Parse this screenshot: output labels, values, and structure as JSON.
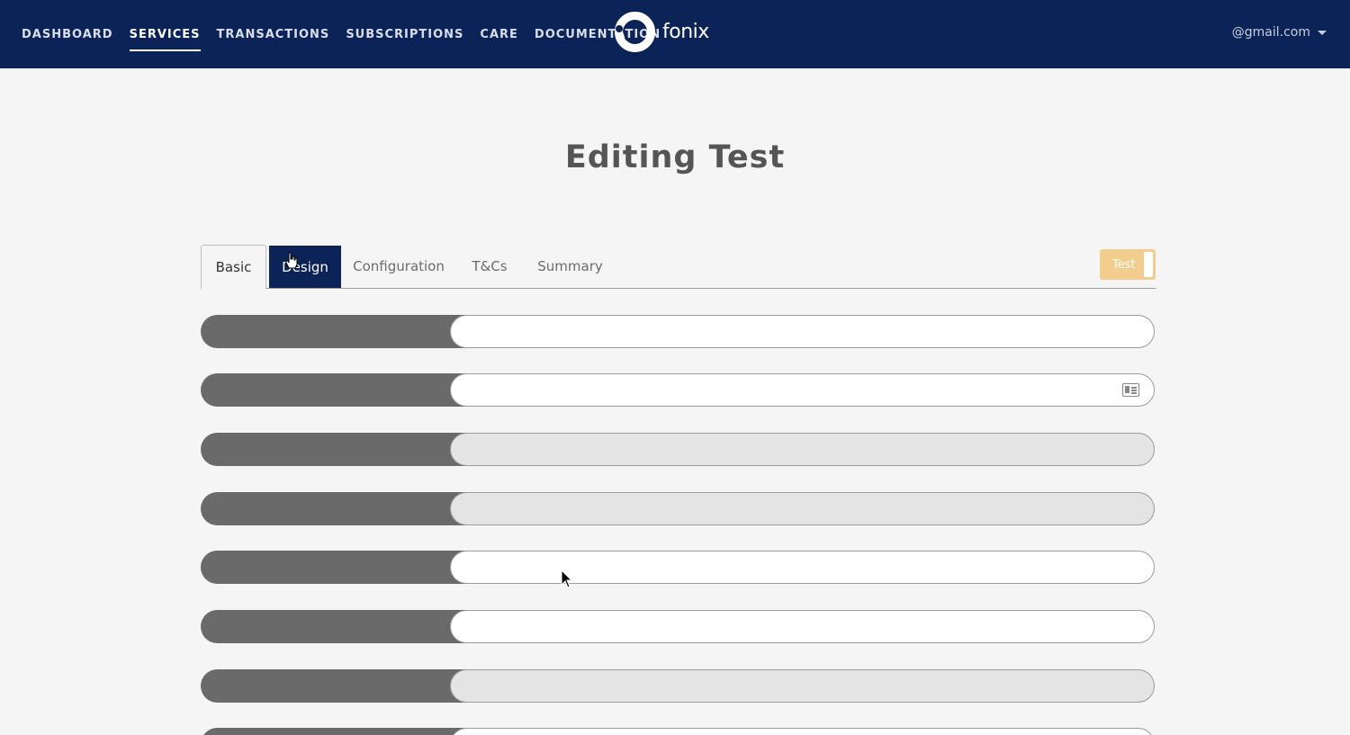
{
  "nav": {
    "items": [
      {
        "label": "DASHBOARD"
      },
      {
        "label": "SERVICES"
      },
      {
        "label": "TRANSACTIONS"
      },
      {
        "label": "SUBSCRIPTIONS"
      },
      {
        "label": "CARE"
      },
      {
        "label": "DOCUMENTATION"
      }
    ],
    "active": "SERVICES"
  },
  "logo": {
    "text": "fonix"
  },
  "account": {
    "email": "@gmail.com"
  },
  "page": {
    "title": "Editing Test"
  },
  "tabs": {
    "basic": "Basic",
    "design": "Design",
    "configuration": "Configuration",
    "tcs": "T&Cs",
    "summary": "Summary",
    "active": "Design"
  },
  "toggle": {
    "label": "Test"
  },
  "colors": {
    "nav_bg": "#0c2357",
    "accent": "#0c2357",
    "toggle": "#f2cd8d"
  }
}
